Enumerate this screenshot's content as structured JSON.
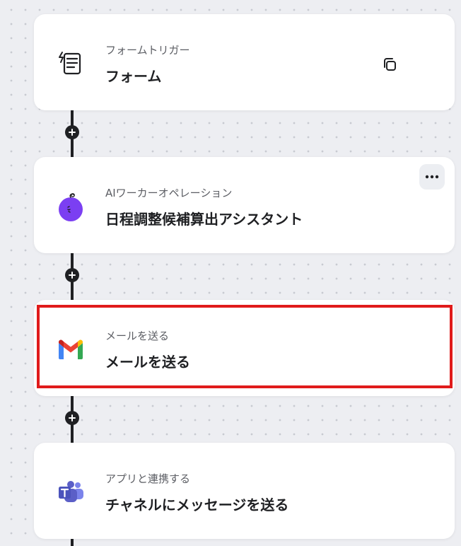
{
  "steps": [
    {
      "subtitle": "フォームトリガー",
      "title": "フォーム",
      "icon": "form-trigger-icon"
    },
    {
      "subtitle": "AIワーカーオペレーション",
      "title": "日程調整候補算出アシスタント",
      "icon": "ai-worker-icon"
    },
    {
      "subtitle": "メールを送る",
      "title": "メールを送る",
      "icon": "gmail-icon"
    },
    {
      "subtitle": "アプリと連携する",
      "title": "チャネルにメッセージを送る",
      "icon": "teams-icon"
    }
  ],
  "colors": {
    "highlight": "#e01b1b",
    "ai_purple": "#7b3ff2",
    "teams_purple": "#5b5fc7",
    "rail": "#1f2023"
  }
}
